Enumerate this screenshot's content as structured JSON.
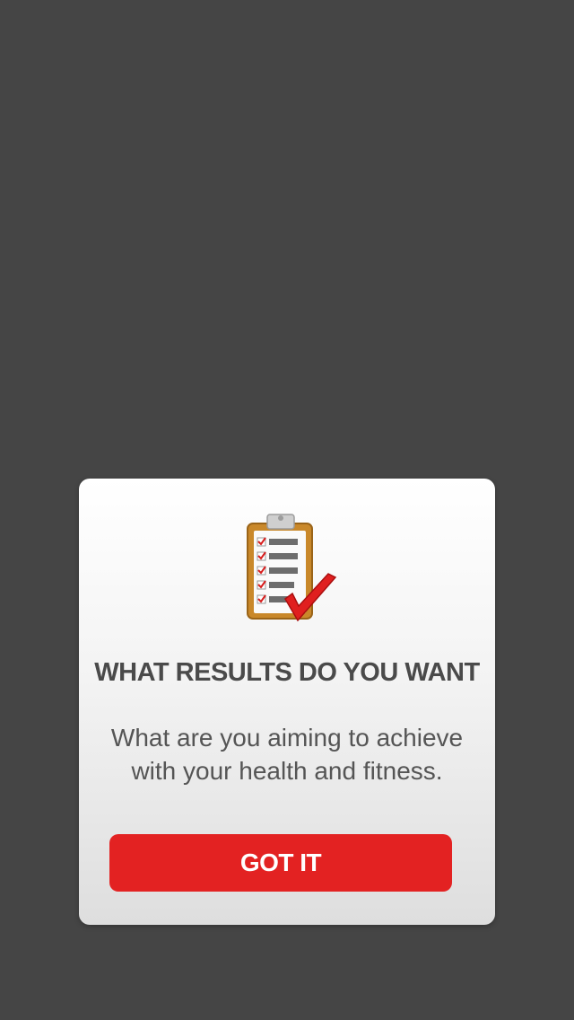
{
  "modal": {
    "icon": "clipboard-checklist-icon",
    "title": "WHAT RESULTS DO YOU WANT",
    "body": "What are you aiming to achieve with your health and fitness.",
    "button_label": "GOT IT"
  },
  "colors": {
    "backdrop": "#454545",
    "button": "#e32222",
    "title_text": "#4a4a4a",
    "body_text": "#555555"
  }
}
